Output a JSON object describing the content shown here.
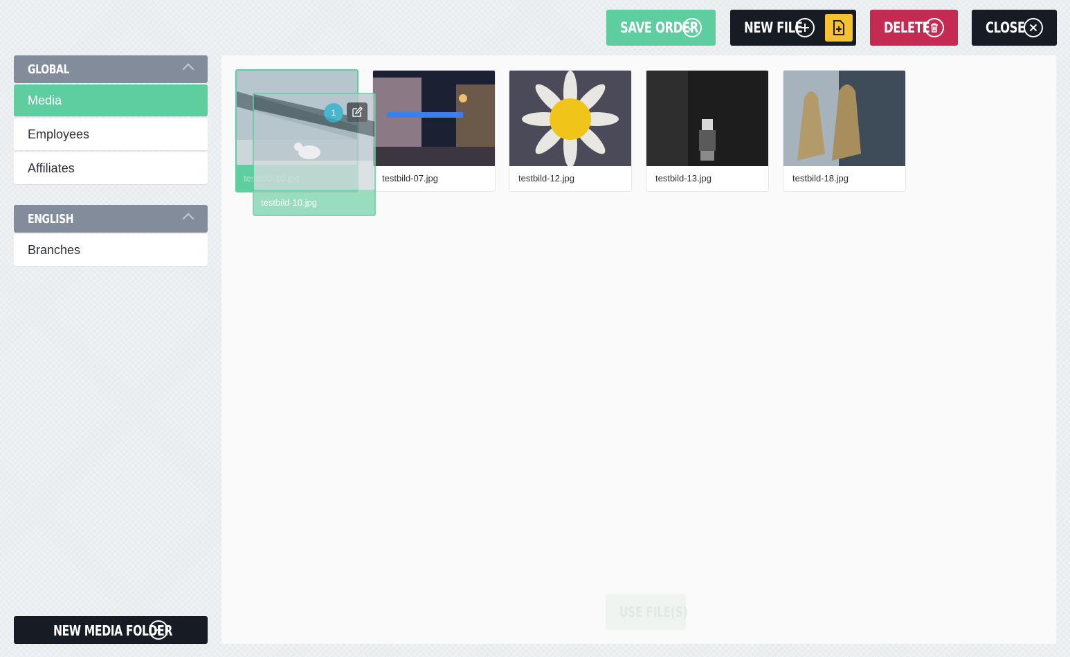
{
  "toolbar": {
    "save_order": "SAVE ORDER",
    "new_file": "NEW FILE",
    "delete": "DELETE",
    "close": "CLOSE"
  },
  "sidebar": {
    "groups": [
      {
        "title": "GLOBAL",
        "items": [
          "Media",
          "Employees",
          "Affiliates"
        ],
        "active": "Media"
      },
      {
        "title": "ENGLISH",
        "items": [
          "Branches"
        ]
      }
    ],
    "new_folder": "NEW MEDIA FOLDER"
  },
  "files": [
    {
      "name": "testbild-10.jpg",
      "state": "dragging",
      "selection_count": "1"
    },
    {
      "name": "testbild-07.jpg"
    },
    {
      "name": "testbild-12.jpg"
    },
    {
      "name": "testbild-13.jpg"
    },
    {
      "name": "testbild-18.jpg"
    }
  ],
  "footer": {
    "use_files": "USE FILE(S)"
  },
  "colors": {
    "accent_green": "#5ecda0",
    "dark": "#171c24",
    "danger": "#c42a52",
    "yellow": "#f6c231",
    "sidebar_head": "#838c9b",
    "badge": "#29b3cf"
  },
  "icons": [
    "check-circle-icon",
    "plus-circle-icon",
    "file-plus-icon",
    "trash-icon",
    "x-circle-icon",
    "chevron-up-icon",
    "edit-icon"
  ]
}
